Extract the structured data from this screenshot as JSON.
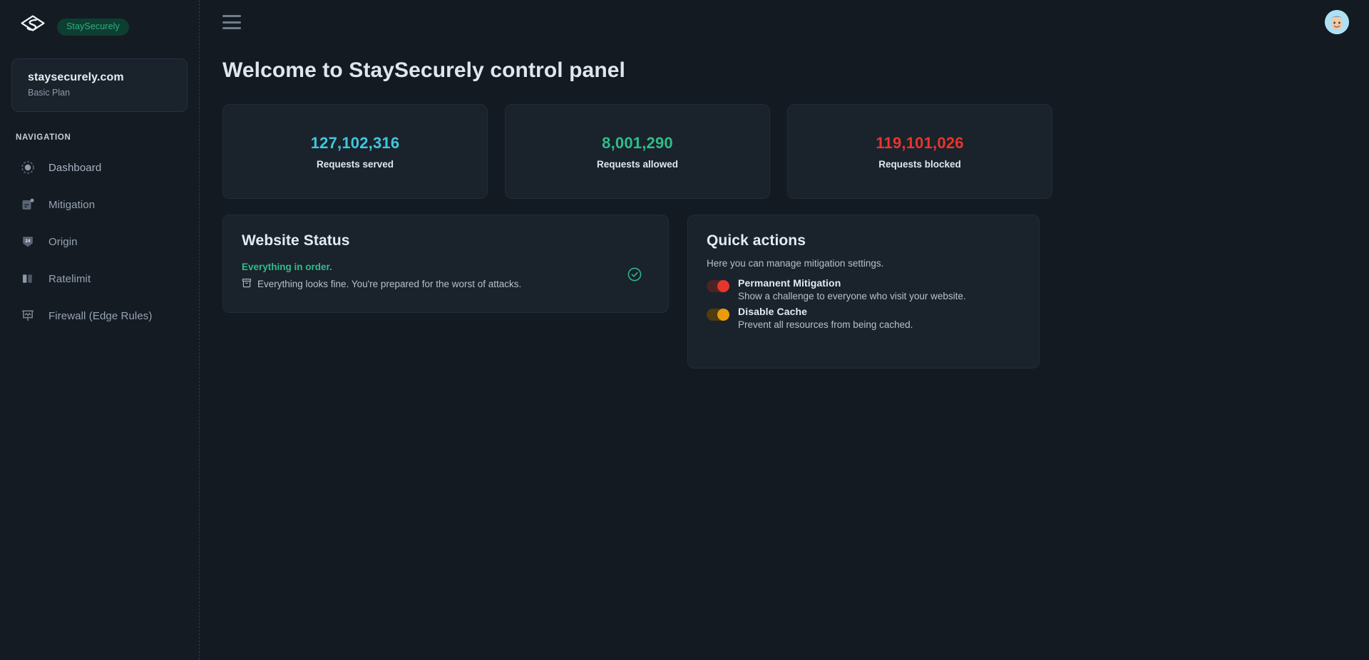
{
  "brand": {
    "pill_label": "StaySecurely",
    "logo_icon": "staysecurely-logo-icon"
  },
  "account": {
    "domain": "staysecurely.com",
    "plan": "Basic Plan"
  },
  "sidebar": {
    "nav_heading": "NAVIGATION",
    "items": [
      {
        "label": "Dashboard",
        "icon": "radio-circle-icon",
        "active": true
      },
      {
        "label": "Mitigation",
        "icon": "document-badge-icon",
        "active": false
      },
      {
        "label": "Origin",
        "icon": "shield-24-icon",
        "active": false
      },
      {
        "label": "Ratelimit",
        "icon": "bars-icon",
        "active": false
      },
      {
        "label": "Firewall (Edge Rules)",
        "icon": "presentation-chart-icon",
        "active": false
      }
    ]
  },
  "topbar": {
    "menu_icon": "hamburger-menu-icon",
    "avatar_icon": "user-avatar-icon"
  },
  "main": {
    "page_title": "Welcome to StaySecurely control panel",
    "stats": [
      {
        "value": "127,102,316",
        "label": "Requests served",
        "color": "#3ec8dd"
      },
      {
        "value": "8,001,290",
        "label": "Requests allowed",
        "color": "#2fbd8a"
      },
      {
        "value": "119,101,026",
        "label": "Requests blocked",
        "color": "#e8352c"
      }
    ],
    "website_status": {
      "title": "Website Status",
      "headline": "Everything in order.",
      "detail_icon": "archive-box-icon",
      "detail": "Everything looks fine. You're prepared for the worst of attacks.",
      "check_icon": "check-circle-icon",
      "check_color": "#2fbd8a"
    },
    "quick_actions": {
      "title": "Quick actions",
      "subtitle": "Here you can manage mitigation settings.",
      "items": [
        {
          "title": "Permanent Mitigation",
          "description": "Show a challenge to everyone who visit your website.",
          "state": "on",
          "track_color": "#4a2326",
          "knob_color": "#e8352c"
        },
        {
          "title": "Disable Cache",
          "description": "Prevent all resources from being cached.",
          "state": "on",
          "track_color": "#4d3d10",
          "knob_color": "#eb9b0a"
        }
      ]
    }
  }
}
